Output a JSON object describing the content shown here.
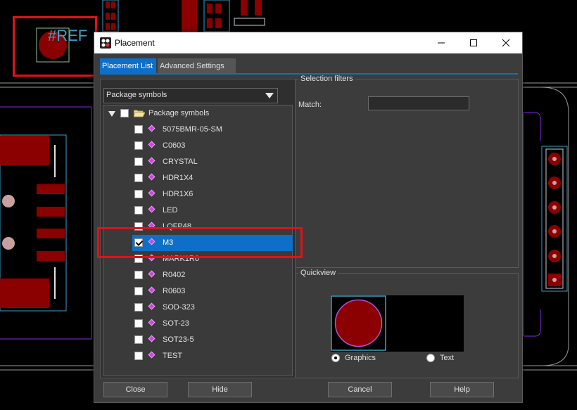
{
  "background": {
    "ref_label": "#REF",
    "colors": {
      "copper": "#8b0000",
      "outline": "#9a9a9a",
      "board_edge": "#8a2be2",
      "pad_outline": "#3aa0c8"
    }
  },
  "window": {
    "title": "Placement",
    "controls": {
      "minimize": "minimize-icon",
      "maximize": "maximize-icon",
      "close": "close-icon"
    }
  },
  "tabs": [
    {
      "label": "Placement List",
      "active": true
    },
    {
      "label": "Advanced Settings",
      "active": false
    }
  ],
  "combo": {
    "value": "Package symbols"
  },
  "tree": {
    "root": {
      "label": "Package symbols",
      "checked": false,
      "expanded": true
    },
    "items": [
      {
        "label": "5075BMR-05-SM",
        "checked": false
      },
      {
        "label": "C0603",
        "checked": false
      },
      {
        "label": "CRYSTAL",
        "checked": false
      },
      {
        "label": "HDR1X4",
        "checked": false
      },
      {
        "label": "HDR1X6",
        "checked": false
      },
      {
        "label": "LED",
        "checked": false
      },
      {
        "label": "LQFP48",
        "checked": false
      },
      {
        "label": "M3",
        "checked": true,
        "selected": true
      },
      {
        "label": "MARK1R0",
        "checked": false
      },
      {
        "label": "R0402",
        "checked": false
      },
      {
        "label": "R0603",
        "checked": false
      },
      {
        "label": "SOD-323",
        "checked": false
      },
      {
        "label": "SOT-23",
        "checked": false
      },
      {
        "label": "SOT23-5",
        "checked": false
      },
      {
        "label": "TEST",
        "checked": false
      }
    ]
  },
  "selection_filters": {
    "title": "Selection filters",
    "match_label": "Match:",
    "match_value": ""
  },
  "quickview": {
    "title": "Quickview",
    "mode_options": [
      {
        "label": "Graphics",
        "selected": true
      },
      {
        "label": "Text",
        "selected": false
      }
    ]
  },
  "buttons": {
    "close": "Close",
    "hide": "Hide",
    "cancel": "Cancel",
    "help": "Help"
  },
  "accent_color": "#0e6fc8"
}
